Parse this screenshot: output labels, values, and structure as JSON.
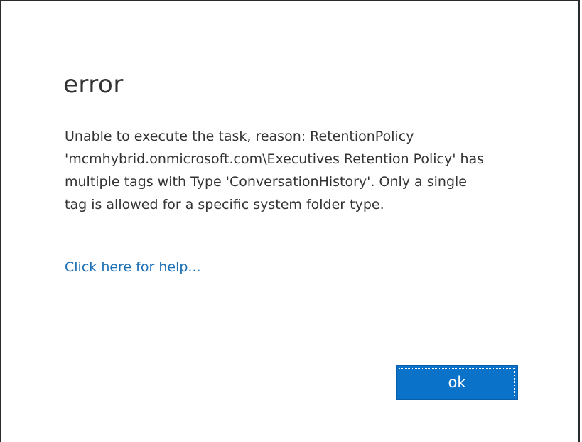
{
  "dialog": {
    "title": "error",
    "message_lines": [
      "Unable to execute the task, reason: RetentionPolicy",
      "'mcmhybrid.onmicrosoft.com\\Executives Retention Policy' has",
      "multiple tags with Type 'ConversationHistory'. Only a single",
      "tag is allowed for a specific system folder type."
    ],
    "help_link": "Click here for help...",
    "ok_label": "ok"
  },
  "colors": {
    "link": "#1a6fb5",
    "button_bg": "#0a72c8",
    "text": "#333333"
  }
}
